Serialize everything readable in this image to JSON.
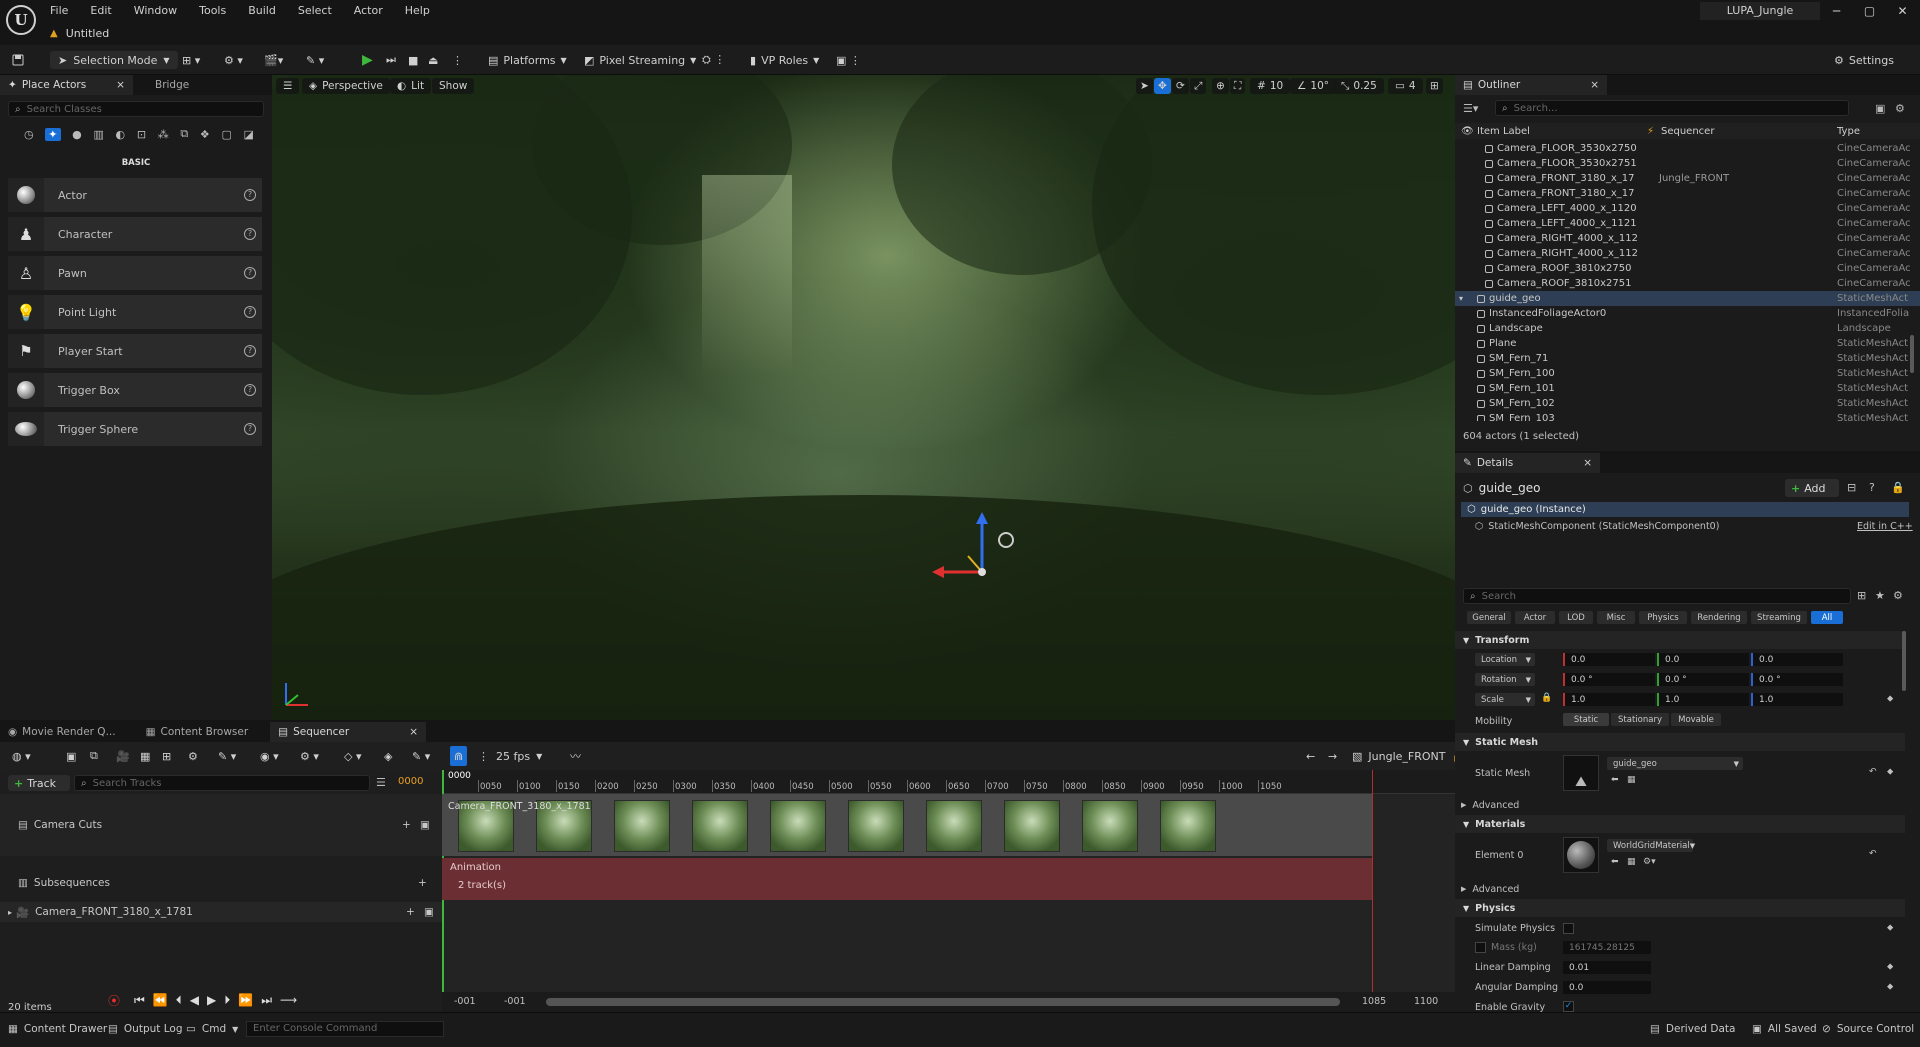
{
  "app": {
    "menu": [
      "File",
      "Edit",
      "Window",
      "Tools",
      "Build",
      "Select",
      "Actor",
      "Help"
    ],
    "document_tab": "Untitled",
    "project": "LUPA_Jungle",
    "window_controls": [
      "─",
      "▢",
      "✕"
    ]
  },
  "toolbar": {
    "selection_mode": "Selection Mode",
    "platforms": "Platforms",
    "pixel_streaming": "Pixel Streaming",
    "vp_roles": "VP Roles",
    "settings": "Settings"
  },
  "place_actors": {
    "tabs": [
      "Place Actors",
      "Bridge"
    ],
    "search_placeholder": "Search Classes",
    "category": "BASIC",
    "items": [
      "Actor",
      "Character",
      "Pawn",
      "Point Light",
      "Player Start",
      "Trigger Box",
      "Trigger Sphere"
    ]
  },
  "viewport": {
    "perspective": "Perspective",
    "lit": "Lit",
    "show": "Show",
    "grid_size": "10",
    "rotation_snap": "10°",
    "scale_snap": "0.25",
    "camera_speed": "4"
  },
  "bottom_tabs": [
    "Movie Render Q...",
    "Content Browser",
    "Sequencer"
  ],
  "sequencer": {
    "fps": "25 fps",
    "sequence_name": "Jungle_FRONT",
    "add_track": "Track",
    "search_placeholder": "Search Tracks",
    "current_frame": "0000",
    "playhead": "0000",
    "tracks": [
      "Camera Cuts",
      "Subsequences",
      "Camera_FRONT_3180_x_1781"
    ],
    "item_count": "20 items",
    "ruler": [
      "0050",
      "0100",
      "0150",
      "0200",
      "0250",
      "0300",
      "0350",
      "0400",
      "0450",
      "0500",
      "0550",
      "0600",
      "0650",
      "0700",
      "0750",
      "0800",
      "0850",
      "0900",
      "0950",
      "1000",
      "1050"
    ],
    "camera_cut_label": "Camera_FRONT_3180_x_1781",
    "animation_label": "Animation",
    "animation_tracks": "2 track(s)",
    "range_start_a": "-001",
    "range_start_b": "-001",
    "range_end_a": "1085",
    "range_end_b": "1100"
  },
  "outliner": {
    "tab": "Outliner",
    "search_placeholder": "Search...",
    "columns": {
      "label": "Item Label",
      "sequencer": "Sequencer",
      "type": "Type"
    },
    "rows": [
      {
        "name": "Camera_FLOOR_3530x2750",
        "seq": "",
        "type": "CineCameraAc",
        "indent": 2
      },
      {
        "name": "Camera_FLOOR_3530x2751",
        "seq": "",
        "type": "CineCameraAc",
        "indent": 2
      },
      {
        "name": "Camera_FRONT_3180_x_17",
        "seq": "Jungle_FRONT",
        "type": "CineCameraAc",
        "indent": 2
      },
      {
        "name": "Camera_FRONT_3180_x_17",
        "seq": "",
        "type": "CineCameraAc",
        "indent": 2
      },
      {
        "name": "Camera_LEFT_4000_x_1120",
        "seq": "",
        "type": "CineCameraAc",
        "indent": 2
      },
      {
        "name": "Camera_LEFT_4000_x_1121",
        "seq": "",
        "type": "CineCameraAc",
        "indent": 2
      },
      {
        "name": "Camera_RIGHT_4000_x_112",
        "seq": "",
        "type": "CineCameraAc",
        "indent": 2
      },
      {
        "name": "Camera_RIGHT_4000_x_112",
        "seq": "",
        "type": "CineCameraAc",
        "indent": 2
      },
      {
        "name": "Camera_ROOF_3810x2750",
        "seq": "",
        "type": "CineCameraAc",
        "indent": 2
      },
      {
        "name": "Camera_ROOF_3810x2751",
        "seq": "",
        "type": "CineCameraAc",
        "indent": 2
      },
      {
        "name": "guide_geo",
        "seq": "",
        "type": "StaticMeshAct",
        "indent": 1,
        "selected": true
      },
      {
        "name": "InstancedFoliageActor0",
        "seq": "",
        "type": "InstancedFolia",
        "indent": 1
      },
      {
        "name": "Landscape",
        "seq": "",
        "type": "Landscape",
        "indent": 1
      },
      {
        "name": "Plane",
        "seq": "",
        "type": "StaticMeshAct",
        "indent": 1
      },
      {
        "name": "SM_Fern_71",
        "seq": "",
        "type": "StaticMeshAct",
        "indent": 1
      },
      {
        "name": "SM_Fern_100",
        "seq": "",
        "type": "StaticMeshAct",
        "indent": 1
      },
      {
        "name": "SM_Fern_101",
        "seq": "",
        "type": "StaticMeshAct",
        "indent": 1
      },
      {
        "name": "SM_Fern_102",
        "seq": "",
        "type": "StaticMeshAct",
        "indent": 1
      },
      {
        "name": "SM_Fern_103",
        "seq": "",
        "type": "StaticMeshAct",
        "indent": 1
      }
    ],
    "status": "604 actors (1 selected)"
  },
  "details": {
    "tab": "Details",
    "object": "guide_geo",
    "add": "Add",
    "instance": "guide_geo (Instance)",
    "component": "StaticMeshComponent (StaticMeshComponent0)",
    "edit_cpp": "Edit in C++",
    "search_placeholder": "Search",
    "categories": [
      "General",
      "Actor",
      "LOD",
      "Misc",
      "Physics",
      "Rendering",
      "Streaming",
      "All"
    ],
    "transform": {
      "section": "Transform",
      "location": "Location",
      "rotation": "Rotation",
      "scale": "Scale",
      "loc": [
        "0.0",
        "0.0",
        "0.0"
      ],
      "rot": [
        "0.0 °",
        "0.0 °",
        "0.0 °"
      ],
      "scl": [
        "1.0",
        "1.0",
        "1.0"
      ],
      "mobility": "Mobility",
      "mobility_options": [
        "Static",
        "Stationary",
        "Movable"
      ]
    },
    "static_mesh": {
      "section": "Static Mesh",
      "label": "Static Mesh",
      "value": "guide_geo",
      "advanced": "Advanced"
    },
    "materials": {
      "section": "Materials",
      "label": "Element 0",
      "value": "WorldGridMaterial",
      "advanced": "Advanced"
    },
    "physics": {
      "section": "Physics",
      "simulate": "Simulate Physics",
      "mass_label": "Mass (kg)",
      "mass": "161745.28125",
      "linear_label": "Linear Damping",
      "linear": "0.01",
      "angular_label": "Angular Damping",
      "angular": "0.0",
      "gravity_label": "Enable Gravity"
    }
  },
  "statusbar": {
    "content_drawer": "Content Drawer",
    "output_log": "Output Log",
    "cmd": "Cmd",
    "console_placeholder": "Enter Console Command",
    "derived_data": "Derived Data",
    "all_saved": "All Saved",
    "source_control": "Source Control"
  },
  "colors": {
    "accent": "#1a6fd6",
    "selection": "#2d3e55",
    "play": "#3db83d",
    "animation": "#6b2f33"
  }
}
